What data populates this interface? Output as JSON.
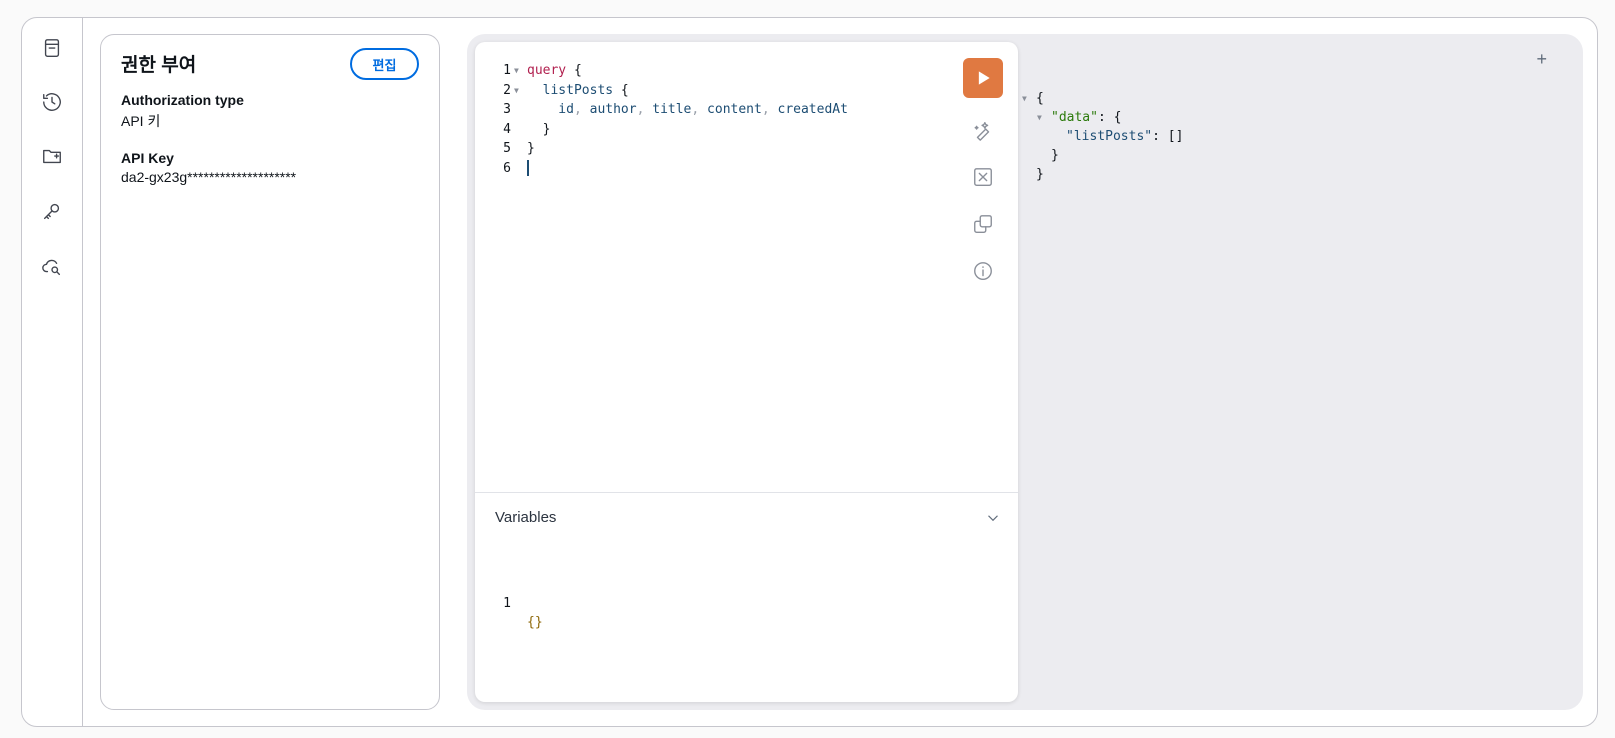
{
  "rail": {
    "items": [
      {
        "icon": "document-icon"
      },
      {
        "icon": "history-icon"
      },
      {
        "icon": "folder-add-icon"
      },
      {
        "icon": "key-icon"
      },
      {
        "icon": "cloud-search-icon"
      }
    ]
  },
  "auth": {
    "title": "권한 부여",
    "edit_label": "편집",
    "auth_type_label": "Authorization type",
    "auth_type_value": "API 키",
    "api_key_label": "API Key",
    "api_key_value": "da2-gx23g********************"
  },
  "editor": {
    "lines": [
      {
        "number": "1",
        "parts": [
          [
            "kw",
            "query"
          ],
          [
            "punct",
            " {"
          ]
        ],
        "fold": true
      },
      {
        "number": "2",
        "parts": [
          [
            "field",
            "  listPosts"
          ],
          [
            "punct",
            " {"
          ]
        ],
        "fold": true
      },
      {
        "number": "3",
        "parts": [
          [
            "field",
            "    id"
          ],
          [
            "comma",
            ", "
          ],
          [
            "field",
            "author"
          ],
          [
            "comma",
            ", "
          ],
          [
            "field",
            "title"
          ],
          [
            "comma",
            ", "
          ],
          [
            "field",
            "content"
          ],
          [
            "comma",
            ", "
          ],
          [
            "field",
            "createdAt"
          ]
        ],
        "fold": false
      },
      {
        "number": "4",
        "parts": [
          [
            "punct",
            "  }"
          ]
        ],
        "fold": false
      },
      {
        "number": "5",
        "parts": [
          [
            "punct",
            "}"
          ]
        ],
        "fold": false
      },
      {
        "number": "6",
        "parts": [],
        "fold": false,
        "cursor": true
      }
    ],
    "tools": [
      "prettify-icon",
      "merge-icon",
      "copy-icon",
      "info-icon"
    ]
  },
  "variables": {
    "title": "Variables",
    "line_number": "1",
    "value": "{}"
  },
  "result": {
    "lines": [
      {
        "indent": "",
        "fold": true,
        "parts": [
          [
            "punct",
            "{"
          ]
        ]
      },
      {
        "indent": "  ",
        "fold": true,
        "parts": [
          [
            "key",
            "\"data\""
          ],
          [
            "punct",
            ": {"
          ]
        ]
      },
      {
        "indent": "    ",
        "fold": false,
        "parts": [
          [
            "field",
            "\"listPosts\""
          ],
          [
            "punct",
            ": []"
          ]
        ]
      },
      {
        "indent": "  ",
        "fold": false,
        "parts": [
          [
            "punct",
            "}"
          ]
        ]
      },
      {
        "indent": "",
        "fold": false,
        "parts": [
          [
            "punct",
            "}"
          ]
        ]
      }
    ],
    "add_label": "+"
  }
}
